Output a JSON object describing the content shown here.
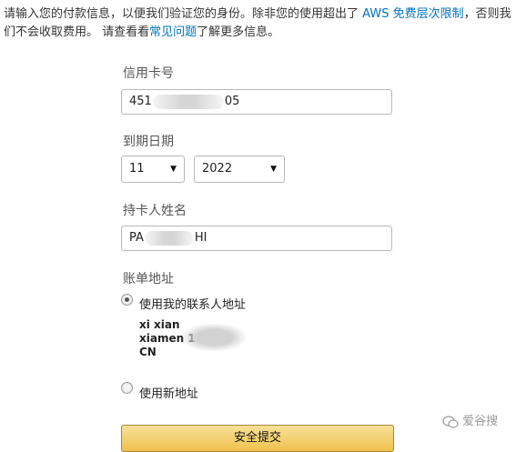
{
  "intro": {
    "text_1": "请输入您的付款信息，以便我们验证您的身份。除非您的使用超出了",
    "link_free_tier": "AWS 免费层次限制",
    "text_2": "，否则我们不会收取费用。 请查看看",
    "link_faq": "常见问题",
    "text_3": "了解更多信息。"
  },
  "card": {
    "label": "信用卡号",
    "value_prefix": "451",
    "value_suffix": "05"
  },
  "expiry": {
    "label": "到期日期",
    "month": "11",
    "year": "2022",
    "arrow": "▼"
  },
  "holder": {
    "label": "持卡人姓名",
    "value_prefix": "PA",
    "value_suffix": "HI"
  },
  "billing": {
    "label": "账单地址",
    "option_contact": "使用我的联系人地址",
    "option_contact_checked": true,
    "address_line1": "xi                    xian",
    "address_line2": "xiamen            102",
    "address_line3": "CN",
    "option_new": "使用新地址",
    "option_new_checked": false
  },
  "submit_label": "安全提交",
  "watermark_text": "爱谷搜",
  "colors": {
    "link": "#0073bb",
    "button_top": "#f7e19a",
    "button_bottom": "#f0c14b"
  }
}
